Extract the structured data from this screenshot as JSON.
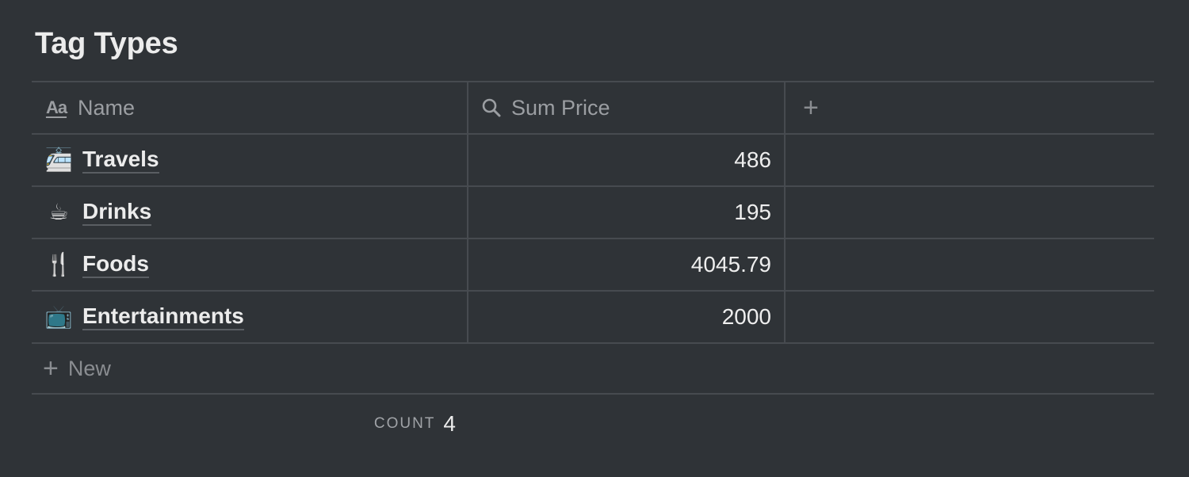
{
  "page_title": "Tag Types",
  "columns": {
    "name": {
      "label": "Name",
      "icon": "text-property-icon"
    },
    "sum_price": {
      "label": "Sum Price",
      "icon": "search-icon"
    },
    "add": {
      "icon": "plus-icon"
    }
  },
  "rows": [
    {
      "emoji": "🚈",
      "emoji_name": "tram-icon",
      "name": "Travels",
      "sum_price": "486"
    },
    {
      "emoji": "☕",
      "emoji_name": "coffee-icon",
      "name": "Drinks",
      "sum_price": "195"
    },
    {
      "emoji": "🍴",
      "emoji_name": "fork-knife-icon",
      "name": "Foods",
      "sum_price": "4045.79"
    },
    {
      "emoji": "📺",
      "emoji_name": "television-icon",
      "name": "Entertainments",
      "sum_price": "2000"
    }
  ],
  "new_row": {
    "label": "New"
  },
  "footer": {
    "count_label": "COUNT",
    "count_value": "4"
  }
}
